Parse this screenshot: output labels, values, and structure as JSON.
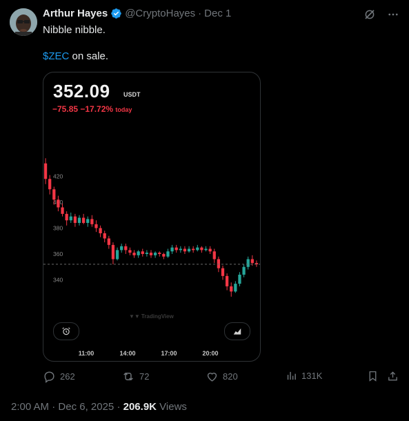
{
  "author": {
    "name": "Arthur Hayes",
    "handle": "@CryptoHayes",
    "separator": "·",
    "date": "Dec 1"
  },
  "tweet": {
    "line1": "Nibble nibble.",
    "cashtag": "$ZEC",
    "line2_rest": " on sale."
  },
  "chart_card": {
    "price": "352.09",
    "unit": "USDT",
    "change": "−75.85 −17.72%",
    "change_suffix": "today",
    "watermark": "TradingView",
    "colors": {
      "up": "#26a69a",
      "down": "#f23645",
      "axis": "#8a8a8a"
    }
  },
  "chart_data": {
    "type": "candlestick",
    "y_ticks": [
      "420",
      "400",
      "380",
      "360",
      "340"
    ],
    "x_ticks": [
      "11:00",
      "14:00",
      "17:00",
      "20:00"
    ],
    "ylim": [
      320,
      432
    ],
    "last_price": 352.09,
    "candles": [
      [
        430,
        418,
        434,
        414
      ],
      [
        418,
        410,
        421,
        406
      ],
      [
        410,
        402,
        412,
        398
      ],
      [
        402,
        396,
        405,
        393
      ],
      [
        396,
        391,
        399,
        389
      ],
      [
        391,
        386,
        393,
        382
      ],
      [
        386,
        389,
        392,
        384
      ],
      [
        389,
        384,
        391,
        381
      ],
      [
        384,
        388,
        390,
        382
      ],
      [
        388,
        384,
        391,
        383
      ],
      [
        384,
        387,
        389,
        381
      ],
      [
        387,
        383,
        390,
        381
      ],
      [
        383,
        380,
        386,
        377
      ],
      [
        380,
        376,
        382,
        373
      ],
      [
        376,
        372,
        378,
        369
      ],
      [
        372,
        367,
        374,
        364
      ],
      [
        367,
        356,
        369,
        352
      ],
      [
        356,
        363,
        365,
        355
      ],
      [
        363,
        366,
        368,
        361
      ],
      [
        366,
        363,
        368,
        360
      ],
      [
        363,
        361,
        365,
        359
      ],
      [
        361,
        359,
        363,
        357
      ],
      [
        359,
        362,
        363,
        357
      ],
      [
        362,
        360,
        364,
        358
      ],
      [
        360,
        361,
        363,
        358
      ],
      [
        361,
        359,
        363,
        357
      ],
      [
        359,
        361,
        362,
        357
      ],
      [
        361,
        360,
        362,
        358
      ],
      [
        360,
        358,
        361,
        356
      ],
      [
        358,
        362,
        364,
        357
      ],
      [
        362,
        365,
        367,
        360
      ],
      [
        365,
        363,
        367,
        361
      ],
      [
        363,
        364,
        366,
        361
      ],
      [
        364,
        362,
        366,
        360
      ],
      [
        362,
        364,
        366,
        361
      ],
      [
        364,
        363,
        366,
        361
      ],
      [
        363,
        365,
        367,
        362
      ],
      [
        365,
        363,
        366,
        361
      ],
      [
        363,
        364,
        366,
        362
      ],
      [
        364,
        362,
        366,
        360
      ],
      [
        362,
        356,
        364,
        353
      ],
      [
        356,
        349,
        358,
        346
      ],
      [
        349,
        343,
        351,
        340
      ],
      [
        343,
        335,
        345,
        332
      ],
      [
        335,
        331,
        338,
        327
      ],
      [
        331,
        337,
        339,
        330
      ],
      [
        337,
        344,
        346,
        335
      ],
      [
        344,
        350,
        352,
        342
      ],
      [
        350,
        356,
        358,
        348
      ],
      [
        356,
        353,
        359,
        351
      ],
      [
        353,
        352,
        355,
        350
      ]
    ]
  },
  "actions": {
    "replies": "262",
    "reposts": "72",
    "likes": "820",
    "views": "131K"
  },
  "footer": {
    "time": "2:00 AM",
    "sep1": "·",
    "date": "Dec 6, 2025",
    "sep2": "·",
    "views_count": "206.9K",
    "views_label": "Views"
  }
}
